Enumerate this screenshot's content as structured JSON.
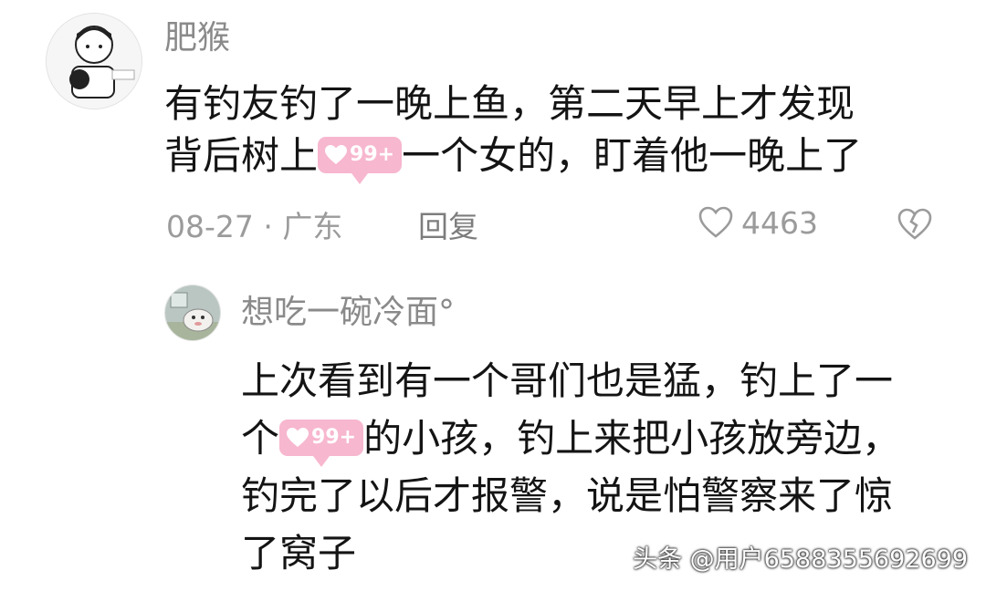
{
  "comment": {
    "username": "肥猴",
    "text_line1": "有钓友钓了一晚上鱼，第二天早上才发现",
    "text_line2_before": "背后树上",
    "text_line2_after": "一个女的，盯着他一晚上了",
    "sticker_count": "99+",
    "date_location": "08-27 · 广东",
    "reply_label": "回复",
    "like_count": "4463"
  },
  "reply": {
    "username": "想吃一碗冷面°",
    "text_line1": "上次看到有一个哥们也是猛，钓上了一",
    "text_line2_before": "个",
    "text_line2_after": "的小孩，钓上来把小孩放旁边，",
    "text_line3": "钓完了以后才报警，说是怕警察来了惊",
    "text_line4": "了窝子",
    "sticker_count": "99+"
  },
  "watermark": "头条 @用户6588355692699",
  "icons": {
    "like": "heart-outline-icon",
    "dislike": "broken-heart-icon",
    "sticker": "heart-sticker-icon"
  },
  "colors": {
    "sticker_bg": "#f7b7cf",
    "meta_gray": "#9b9b9b"
  }
}
